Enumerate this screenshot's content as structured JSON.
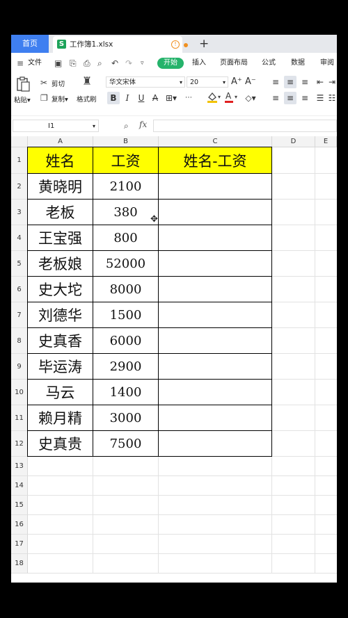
{
  "tabbar": {
    "home": "首页",
    "doc_name": "工作簿1.xlsx",
    "new_tab": "+",
    "app_icon_letter": "S"
  },
  "menu": {
    "file": "文件",
    "start": "开始",
    "insert": "插入",
    "layout": "页面布局",
    "formula": "公式",
    "data": "数据",
    "review": "审阅"
  },
  "ribbon": {
    "paste": "粘贴",
    "cut": "剪切",
    "copy": "复制",
    "format_painter": "格式刷",
    "font_name": "华文宋体",
    "font_size": "20",
    "bold": "B",
    "italic": "I",
    "underline": "U",
    "strike": "A",
    "grow_font": "A⁺",
    "shrink_font": "A⁻",
    "font_color_letter": "A"
  },
  "formula_bar": {
    "name_box": "I1",
    "fx": "fx",
    "formula": ""
  },
  "columns": [
    "A",
    "B",
    "C",
    "D",
    "E"
  ],
  "rows": [
    "1",
    "2",
    "3",
    "4",
    "5",
    "6",
    "7",
    "8",
    "9",
    "10",
    "11",
    "12",
    "13",
    "14",
    "15",
    "16",
    "17",
    "18"
  ],
  "table": {
    "headers": [
      "姓名",
      "工资",
      "姓名-工资"
    ],
    "names": [
      "黄晓明",
      "老板",
      "王宝强",
      "老板娘",
      "史大坨",
      "刘德华",
      "史真香",
      "毕运涛",
      "马云",
      "赖月精",
      "史真贵"
    ],
    "salaries": [
      "2100",
      "380",
      "800",
      "52000",
      "8000",
      "1500",
      "6000",
      "2900",
      "1400",
      "3000",
      "7500"
    ]
  },
  "colors": {
    "header_fill": "#ffff00",
    "accent": "#3f7ff0",
    "start_green": "#25b36b"
  }
}
